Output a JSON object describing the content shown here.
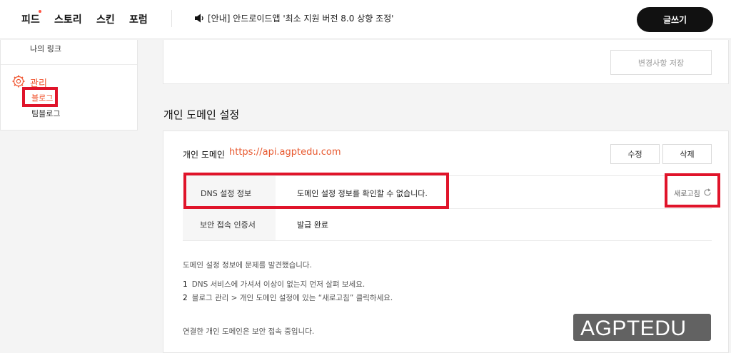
{
  "header": {
    "nav": [
      "피드",
      "스토리",
      "스킨",
      "포럼"
    ],
    "notice": "[안내] 안드로이드앱 '최소 지원 버전 8.0 상향 조정'",
    "write_label": "글쓰기",
    "feed_badge_color": "#ff5544"
  },
  "sidebar": {
    "my_link": "나의 링크",
    "manage": "관리",
    "blog": "블로그",
    "team_blog": "팀블로그",
    "accent_color": "#f0532d"
  },
  "save_panel": {
    "save_label": "변경사항 저장"
  },
  "section": {
    "title": "개인 도메인 설정"
  },
  "domain": {
    "label": "개인 도메인",
    "url": "https://api.agptedu.com",
    "edit_label": "수정",
    "delete_label": "삭제",
    "rows": [
      {
        "label": "DNS 설정 정보",
        "value": "도메인 설정 정보를 확인할 수 없습니다."
      },
      {
        "label": "보안 접속 인증서",
        "value": "발급 완료"
      }
    ],
    "refresh_label": "새로고침",
    "problem_text": "도메인 설정 정보에 문제를 발견했습니다.",
    "steps": [
      {
        "num": "1",
        "text": "DNS 서비스에 가셔서 이상이 없는지 먼저 살펴 보세요."
      },
      {
        "num": "2",
        "text": "블로그 관리 > 개인 도메인 설정에 있는 “새로고침” 클릭하세요."
      }
    ],
    "secure_text": "연결한 개인 도메인은 보안 접속 중입니다."
  },
  "watermark": "AGPTEDU",
  "colors": {
    "highlight": "#e0142a",
    "url": "#e8582e"
  }
}
